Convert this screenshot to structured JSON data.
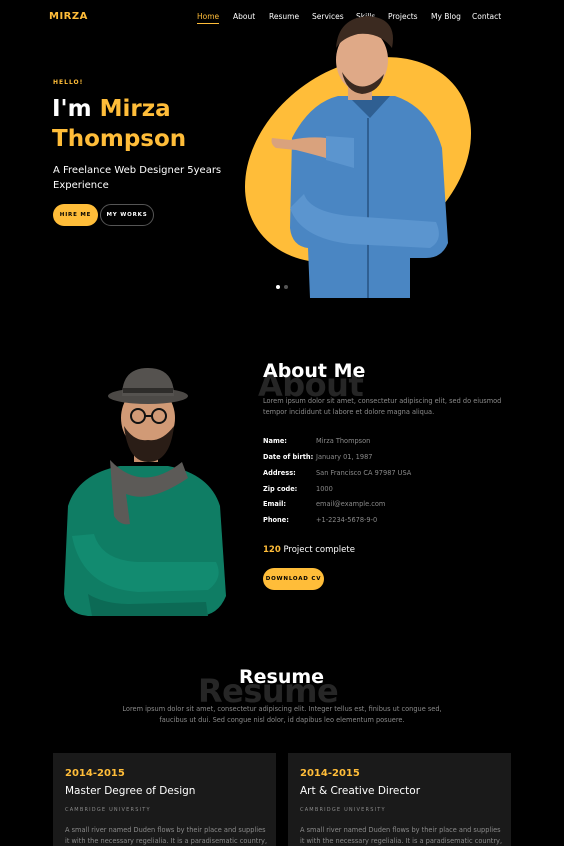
{
  "nav": {
    "logo": "MIRZA",
    "items": [
      "Home",
      "About",
      "Resume",
      "Services",
      "Skills",
      "Projects",
      "My Blog",
      "Contact"
    ],
    "active": "Home"
  },
  "hero": {
    "greeting": "HELLO!",
    "name_prefix": "I'm",
    "first_name": "Mirza",
    "last_name": "Thompson",
    "subtitle": "A Freelance Web Designer 5years Experience",
    "hire_button": "HIRE ME",
    "works_button": "MY WORKS",
    "slide_count": 2,
    "active_slide": 1
  },
  "about": {
    "title": "About Me",
    "ghost": "About",
    "text": "Lorem ipsum dolor sit amet, consectetur adipiscing elit, sed do eiusmod tempor incididunt ut labore et dolore magna aliqua.",
    "info": [
      {
        "label": "Name:",
        "value": "Mirza Thompson"
      },
      {
        "label": "Date of birth:",
        "value": "January 01, 1987"
      },
      {
        "label": "Address:",
        "value": "San Francisco CA 97987 USA"
      },
      {
        "label": "Zip code:",
        "value": "1000"
      },
      {
        "label": "Email:",
        "value": "email@example.com"
      },
      {
        "label": "Phone:",
        "value": "+1-2234-5678-9-0"
      }
    ],
    "project_count": "120",
    "project_label": " Project complete",
    "download_button": "DOWNLOAD CV"
  },
  "resume": {
    "title": "Resume",
    "ghost": "Resume",
    "text": "Lorem ipsum dolor sit amet, consectetur adipiscing elit. Integer tellus est, finibus ut congue sed, faucibus ut dui. Sed congue nisl dolor, id dapibus leo elementum posuere.",
    "cards": [
      {
        "years": "2014-2015",
        "title": "Master Degree of Design",
        "org": "CAMBRIDGE UNIVERSITY",
        "desc": "A small river named Duden flows by their place and supplies it with the necessary regelialia. It is a paradisematic country,"
      },
      {
        "years": "2014-2015",
        "title": "Art & Creative Director",
        "org": "CAMBRIDGE UNIVERSITY",
        "desc": "A small river named Duden flows by their place and supplies it with the necessary regelialia. It is a paradisematic country,"
      }
    ]
  },
  "colors": {
    "accent": "#ffbd39",
    "background": "#000000",
    "card": "#1a1a1a",
    "muted": "#8a8a8a",
    "ghost_text": "#262626"
  }
}
